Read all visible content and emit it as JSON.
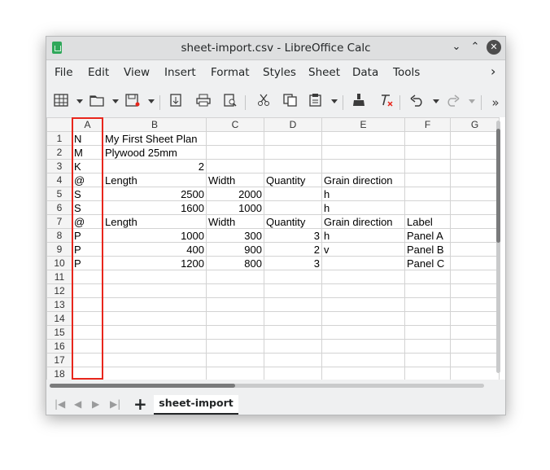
{
  "window": {
    "title": "sheet-import.csv - LibreOffice Calc",
    "minimize_icon": "chevron-down",
    "maximize_icon": "chevron-up",
    "close_icon": "close"
  },
  "menu": [
    "File",
    "Edit",
    "View",
    "Insert",
    "Format",
    "Styles",
    "Sheet",
    "Data",
    "Tools"
  ],
  "menu_more": "›",
  "toolbar_icons": [
    "table-icon",
    "open-icon",
    "save-icon",
    "export-pdf-icon",
    "print-icon",
    "print-preview-icon",
    "cut-icon",
    "copy-icon",
    "paste-icon",
    "clone-formatting-icon",
    "clear-formatting-icon",
    "undo-icon",
    "redo-icon",
    "more-icon"
  ],
  "columns": [
    "A",
    "B",
    "C",
    "D",
    "E",
    "F",
    "G"
  ],
  "rows": [
    {
      "n": "1",
      "cells": [
        "N",
        "My First Sheet Plan",
        "",
        "",
        "",
        ""
      ]
    },
    {
      "n": "2",
      "cells": [
        "M",
        "Plywood 25mm",
        "",
        "",
        "",
        ""
      ]
    },
    {
      "n": "3",
      "cells": [
        "K",
        "2",
        "",
        "",
        "",
        ""
      ]
    },
    {
      "n": "4",
      "cells": [
        "@",
        "Length",
        "Width",
        "Quantity",
        "Grain direction",
        ""
      ]
    },
    {
      "n": "5",
      "cells": [
        "S",
        "2500",
        "2000",
        "",
        "h",
        ""
      ]
    },
    {
      "n": "6",
      "cells": [
        "S",
        "1600",
        "1000",
        "",
        "h",
        ""
      ]
    },
    {
      "n": "7",
      "cells": [
        "@",
        "Length",
        "Width",
        "Quantity",
        "Grain direction",
        "Label"
      ]
    },
    {
      "n": "8",
      "cells": [
        "P",
        "1000",
        "300",
        "3",
        "h",
        "Panel A"
      ]
    },
    {
      "n": "9",
      "cells": [
        "P",
        "400",
        "900",
        "2",
        "v",
        "Panel B"
      ]
    },
    {
      "n": "10",
      "cells": [
        "P",
        "1200",
        "800",
        "3",
        "",
        "Panel C"
      ]
    },
    {
      "n": "11",
      "cells": [
        "",
        "",
        "",
        "",
        "",
        ""
      ]
    },
    {
      "n": "12",
      "cells": [
        "",
        "",
        "",
        "",
        "",
        ""
      ]
    },
    {
      "n": "13",
      "cells": [
        "",
        "",
        "",
        "",
        "",
        ""
      ]
    },
    {
      "n": "14",
      "cells": [
        "",
        "",
        "",
        "",
        "",
        ""
      ]
    },
    {
      "n": "15",
      "cells": [
        "",
        "",
        "",
        "",
        "",
        ""
      ]
    },
    {
      "n": "16",
      "cells": [
        "",
        "",
        "",
        "",
        "",
        ""
      ]
    },
    {
      "n": "17",
      "cells": [
        "",
        "",
        "",
        "",
        "",
        ""
      ]
    },
    {
      "n": "18",
      "cells": [
        "",
        "",
        "",
        "",
        "",
        ""
      ]
    }
  ],
  "sheet_tab": "sheet-import",
  "highlight_color": "#e8261c"
}
